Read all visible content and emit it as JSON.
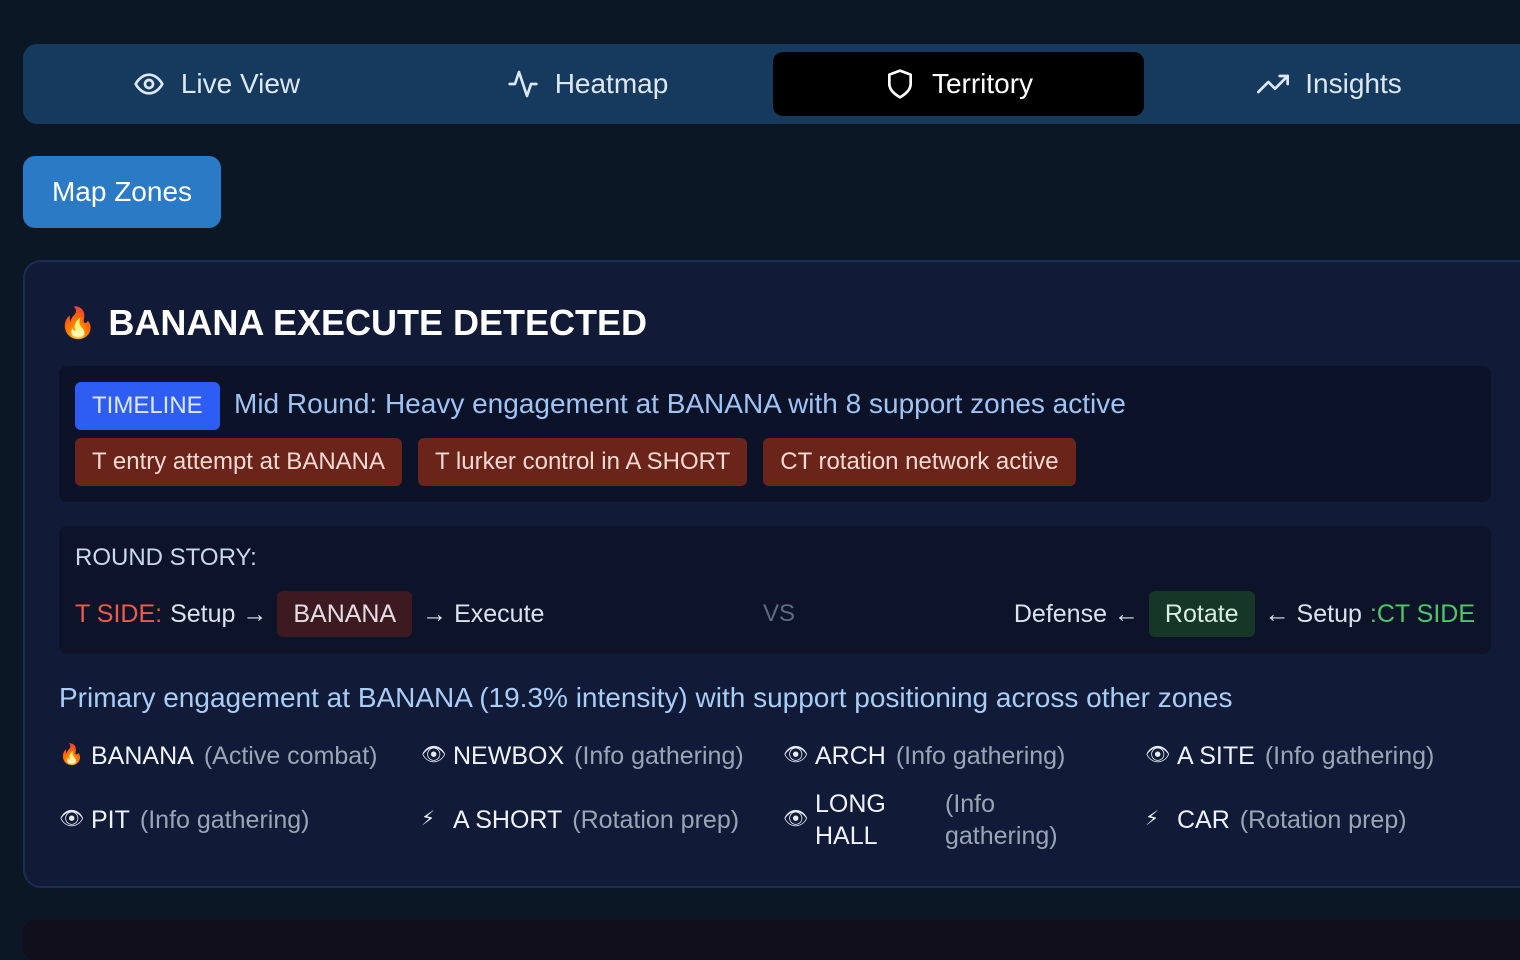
{
  "tabs": [
    {
      "label": "Live View",
      "icon": "eye-icon"
    },
    {
      "label": "Heatmap",
      "icon": "activity-icon"
    },
    {
      "label": "Territory",
      "icon": "shield-icon",
      "active": true
    },
    {
      "label": "Insights",
      "icon": "trending-up-icon"
    }
  ],
  "map_zones_button": "Map Zones",
  "alert": {
    "icon": "fire-icon",
    "title": "BANANA EXECUTE DETECTED",
    "timeline_badge": "TIMELINE",
    "timeline_text": "Mid Round: Heavy engagement at BANANA with 8 support zones active",
    "events": [
      "T entry attempt at BANANA",
      "T lurker control in A SHORT",
      "CT rotation network active"
    ]
  },
  "story": {
    "title": "ROUND STORY:",
    "t_side_label": "T SIDE:",
    "t_setup": "Setup →",
    "t_zone": "BANANA",
    "t_execute": "→ Execute",
    "vs": "VS",
    "ct_defense": "Defense ←",
    "ct_zone": "Rotate",
    "ct_setup": "← Setup",
    "ct_side_label": ":CT SIDE"
  },
  "summary": "Primary engagement at BANANA (19.3% intensity) with support positioning across other zones",
  "zones": [
    {
      "icon": "🔥",
      "name": "BANANA",
      "status": "(Active combat)"
    },
    {
      "icon": "👁",
      "name": "NEWBOX",
      "status": "(Info gathering)"
    },
    {
      "icon": "👁",
      "name": "ARCH",
      "status": "(Info gathering)"
    },
    {
      "icon": "👁",
      "name": "A SITE",
      "status": "(Info gathering)"
    },
    {
      "icon": "👁",
      "name": "PIT",
      "status": "(Info gathering)"
    },
    {
      "icon": "⚡",
      "name": "A SHORT",
      "status": "(Rotation prep)"
    },
    {
      "icon": "👁",
      "name": "LONG HALL",
      "status": "(Info gathering)"
    },
    {
      "icon": "⚡",
      "name": "CAR",
      "status": "(Rotation prep)"
    }
  ],
  "colors": {
    "background": "#0c1726",
    "tab_bar": "#163a5e",
    "active_tab": "#000000",
    "primary_button": "#2b7ac6",
    "timeline_badge": "#2d5df2",
    "event_chip": "#6b2419",
    "t_side": "#ef5a4a",
    "ct_side": "#4cc86a"
  }
}
